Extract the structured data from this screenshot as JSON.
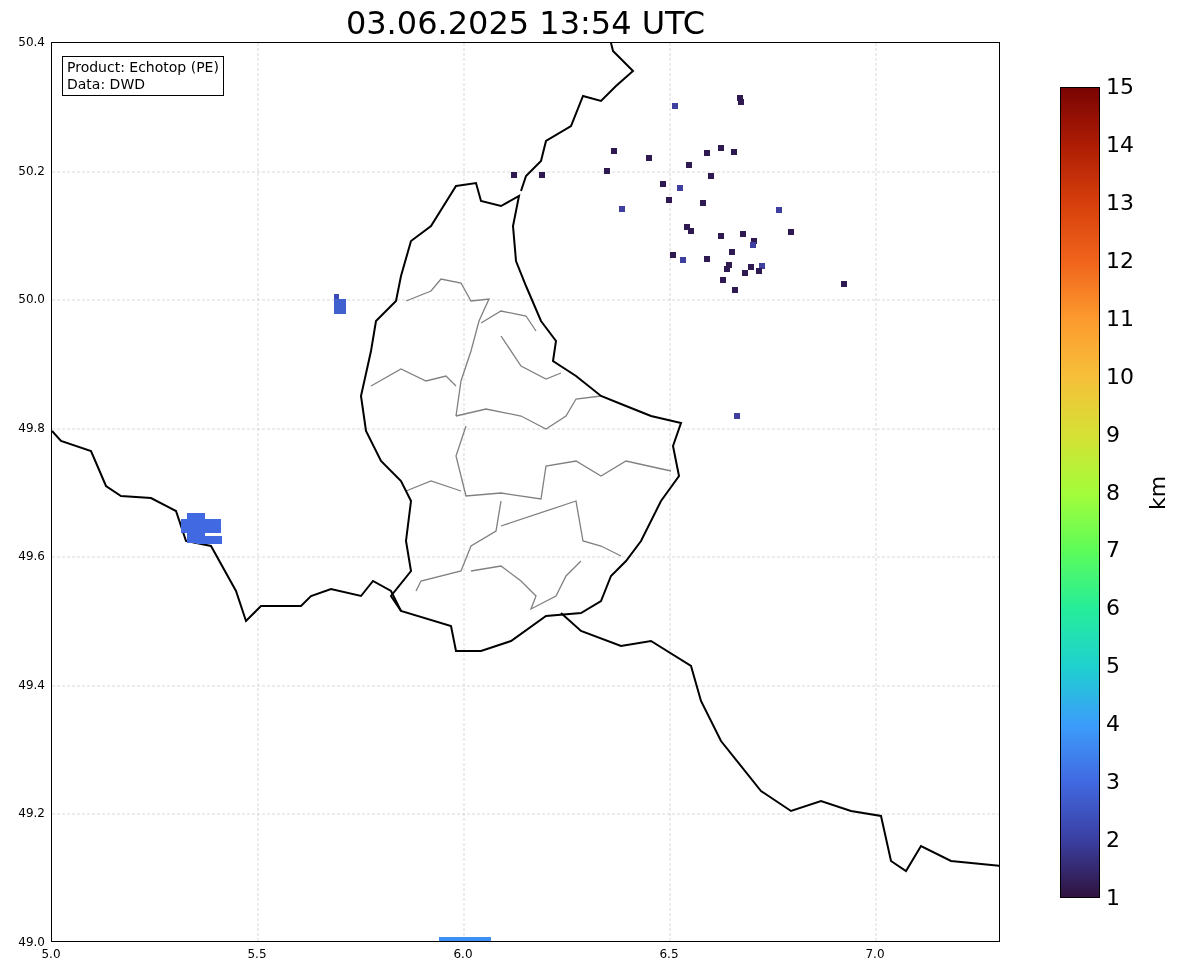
{
  "title": "03.06.2025 13:54 UTC",
  "legend": [
    "Product: Echotop (PE)",
    "Data: DWD"
  ],
  "y_ticks": [
    "50.4",
    "50.2",
    "50.0",
    "49.8",
    "49.6",
    "49.4",
    "49.2",
    "49.0"
  ],
  "x_ticks": [
    "5.0",
    "5.5",
    "6.0",
    "6.5",
    "7.0"
  ],
  "colorbar": {
    "label": "km",
    "ticks": [
      "15",
      "14",
      "13",
      "12",
      "11",
      "10",
      "9",
      "8",
      "7",
      "6",
      "5",
      "4",
      "3",
      "2",
      "1"
    ]
  }
}
